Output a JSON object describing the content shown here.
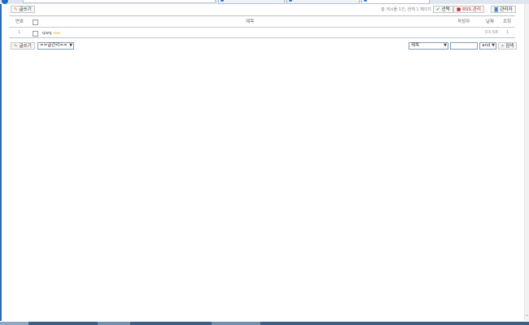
{
  "toolbar": {
    "write_label": "글쓰기",
    "info_text": "총 게시물 1건, 현재 1 페이지",
    "check_label": "선택",
    "rss_label": "RSS 관리",
    "admin_label": "관리자"
  },
  "table": {
    "headers": {
      "num": "번호",
      "subject": "제목",
      "writer": "작성자",
      "date": "날짜",
      "hits": "조회"
    },
    "rows": [
      {
        "num": "1",
        "subject": "qwq",
        "new_mark": "new",
        "writer": "",
        "date": "03:58",
        "hits": "1"
      }
    ]
  },
  "bottom": {
    "write_label": "글쓰기",
    "category_select": "==글관리==",
    "search_field_select": "제목",
    "search_value": "",
    "search_operator": "and",
    "search_label": "검색"
  },
  "colors": {
    "accent": "#2b6bb8",
    "border": "#c5cbd3"
  }
}
